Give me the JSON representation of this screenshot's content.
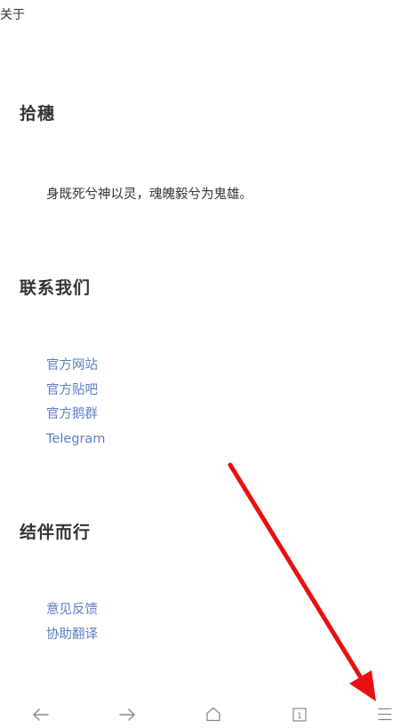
{
  "header": {
    "title": "关于"
  },
  "sections": {
    "shisui": {
      "heading": "拾穗",
      "quote": "身既死兮神以灵，魂魄毅兮为鬼雄。"
    },
    "contact": {
      "heading": "联系我们",
      "links": [
        "官方网站",
        "官方贴吧",
        "官方鹅群",
        "Telegram"
      ]
    },
    "together": {
      "heading": "结伴而行",
      "links": [
        "意见反馈",
        "协助翻译"
      ]
    }
  },
  "bottom_nav": {
    "items": [
      "back-icon",
      "forward-icon",
      "home-icon",
      "tabs-icon",
      "menu-icon"
    ],
    "tab_count": "1"
  },
  "colors": {
    "text": "#333333",
    "link": "#5b7ec8",
    "icon": "#888888",
    "annotation_arrow": "#e81010"
  }
}
